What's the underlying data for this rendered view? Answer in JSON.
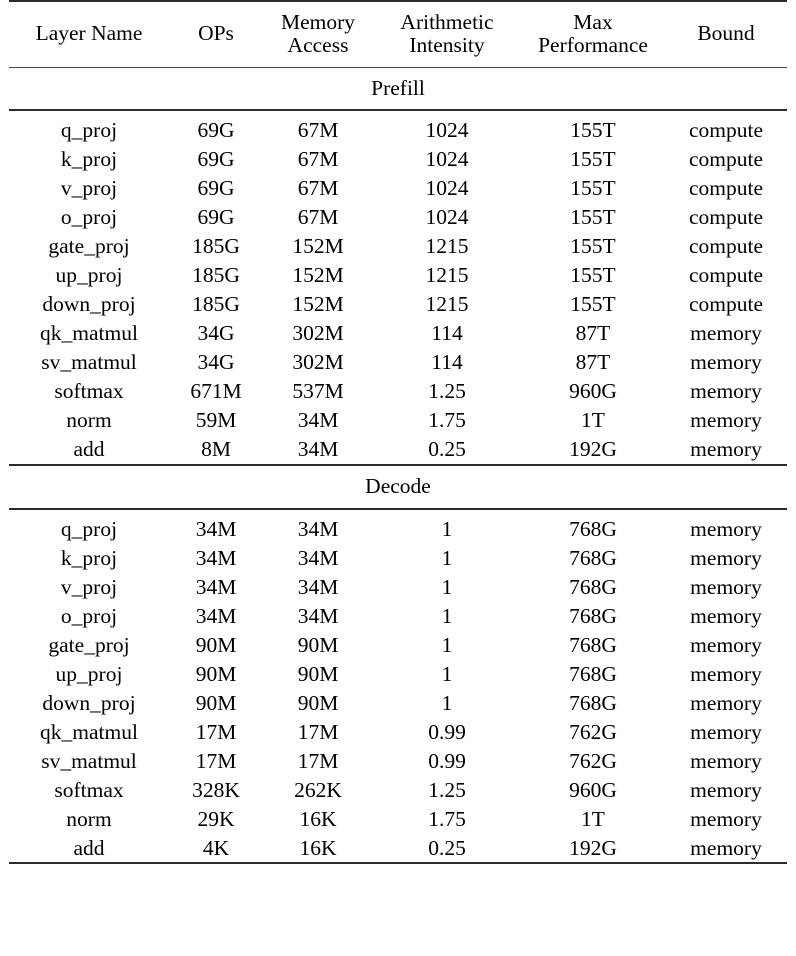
{
  "table": {
    "columns": [
      {
        "id": "layer_name",
        "label_lines": [
          "Layer Name"
        ]
      },
      {
        "id": "ops",
        "label_lines": [
          "OPs"
        ]
      },
      {
        "id": "memory_access",
        "label_lines": [
          "Memory",
          "Access"
        ]
      },
      {
        "id": "arithmetic_intensity",
        "label_lines": [
          "Arithmetic",
          "Intensity"
        ]
      },
      {
        "id": "max_performance",
        "label_lines": [
          "Max",
          "Performance"
        ]
      },
      {
        "id": "bound",
        "label_lines": [
          "Bound"
        ]
      }
    ],
    "sections": [
      {
        "id": "prefill",
        "title": "Prefill",
        "rows": [
          {
            "layer_name": "q_proj",
            "ops": "69G",
            "memory_access": "67M",
            "arithmetic_intensity": "1024",
            "max_performance": "155T",
            "bound": "compute"
          },
          {
            "layer_name": "k_proj",
            "ops": "69G",
            "memory_access": "67M",
            "arithmetic_intensity": "1024",
            "max_performance": "155T",
            "bound": "compute"
          },
          {
            "layer_name": "v_proj",
            "ops": "69G",
            "memory_access": "67M",
            "arithmetic_intensity": "1024",
            "max_performance": "155T",
            "bound": "compute"
          },
          {
            "layer_name": "o_proj",
            "ops": "69G",
            "memory_access": "67M",
            "arithmetic_intensity": "1024",
            "max_performance": "155T",
            "bound": "compute"
          },
          {
            "layer_name": "gate_proj",
            "ops": "185G",
            "memory_access": "152M",
            "arithmetic_intensity": "1215",
            "max_performance": "155T",
            "bound": "compute"
          },
          {
            "layer_name": "up_proj",
            "ops": "185G",
            "memory_access": "152M",
            "arithmetic_intensity": "1215",
            "max_performance": "155T",
            "bound": "compute"
          },
          {
            "layer_name": "down_proj",
            "ops": "185G",
            "memory_access": "152M",
            "arithmetic_intensity": "1215",
            "max_performance": "155T",
            "bound": "compute"
          },
          {
            "layer_name": "qk_matmul",
            "ops": "34G",
            "memory_access": "302M",
            "arithmetic_intensity": "114",
            "max_performance": "87T",
            "bound": "memory"
          },
          {
            "layer_name": "sv_matmul",
            "ops": "34G",
            "memory_access": "302M",
            "arithmetic_intensity": "114",
            "max_performance": "87T",
            "bound": "memory"
          },
          {
            "layer_name": "softmax",
            "ops": "671M",
            "memory_access": "537M",
            "arithmetic_intensity": "1.25",
            "max_performance": "960G",
            "bound": "memory"
          },
          {
            "layer_name": "norm",
            "ops": "59M",
            "memory_access": "34M",
            "arithmetic_intensity": "1.75",
            "max_performance": "1T",
            "bound": "memory"
          },
          {
            "layer_name": "add",
            "ops": "8M",
            "memory_access": "34M",
            "arithmetic_intensity": "0.25",
            "max_performance": "192G",
            "bound": "memory"
          }
        ]
      },
      {
        "id": "decode",
        "title": "Decode",
        "rows": [
          {
            "layer_name": "q_proj",
            "ops": "34M",
            "memory_access": "34M",
            "arithmetic_intensity": "1",
            "max_performance": "768G",
            "bound": "memory"
          },
          {
            "layer_name": "k_proj",
            "ops": "34M",
            "memory_access": "34M",
            "arithmetic_intensity": "1",
            "max_performance": "768G",
            "bound": "memory"
          },
          {
            "layer_name": "v_proj",
            "ops": "34M",
            "memory_access": "34M",
            "arithmetic_intensity": "1",
            "max_performance": "768G",
            "bound": "memory"
          },
          {
            "layer_name": "o_proj",
            "ops": "34M",
            "memory_access": "34M",
            "arithmetic_intensity": "1",
            "max_performance": "768G",
            "bound": "memory"
          },
          {
            "layer_name": "gate_proj",
            "ops": "90M",
            "memory_access": "90M",
            "arithmetic_intensity": "1",
            "max_performance": "768G",
            "bound": "memory"
          },
          {
            "layer_name": "up_proj",
            "ops": "90M",
            "memory_access": "90M",
            "arithmetic_intensity": "1",
            "max_performance": "768G",
            "bound": "memory"
          },
          {
            "layer_name": "down_proj",
            "ops": "90M",
            "memory_access": "90M",
            "arithmetic_intensity": "1",
            "max_performance": "768G",
            "bound": "memory"
          },
          {
            "layer_name": "qk_matmul",
            "ops": "17M",
            "memory_access": "17M",
            "arithmetic_intensity": "0.99",
            "max_performance": "762G",
            "bound": "memory"
          },
          {
            "layer_name": "sv_matmul",
            "ops": "17M",
            "memory_access": "17M",
            "arithmetic_intensity": "0.99",
            "max_performance": "762G",
            "bound": "memory"
          },
          {
            "layer_name": "softmax",
            "ops": "328K",
            "memory_access": "262K",
            "arithmetic_intensity": "1.25",
            "max_performance": "960G",
            "bound": "memory"
          },
          {
            "layer_name": "norm",
            "ops": "29K",
            "memory_access": "16K",
            "arithmetic_intensity": "1.75",
            "max_performance": "1T",
            "bound": "memory"
          },
          {
            "layer_name": "add",
            "ops": "4K",
            "memory_access": "16K",
            "arithmetic_intensity": "0.25",
            "max_performance": "192G",
            "bound": "memory"
          }
        ]
      }
    ]
  }
}
